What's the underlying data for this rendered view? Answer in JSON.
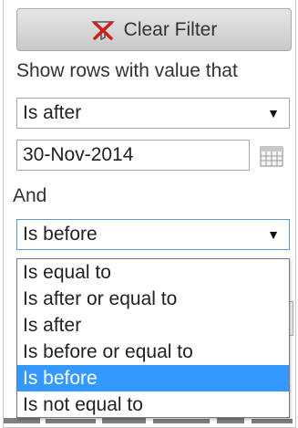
{
  "filter": {
    "clear_button_label": "Clear Filter",
    "clear_icon": "filter-clear-icon",
    "show_rows_label": "Show rows with value that",
    "first_condition": {
      "selected": "Is after",
      "arrow": "▼"
    },
    "date_value": "30-Nov-2014",
    "calendar_icon": "calendar-icon",
    "and_label": "And",
    "second_condition": {
      "selected": "Is before",
      "arrow": "▼"
    },
    "options": [
      {
        "label": "Is equal to",
        "selected": false
      },
      {
        "label": "Is after or equal to",
        "selected": false
      },
      {
        "label": "Is after",
        "selected": false
      },
      {
        "label": "Is before or equal to",
        "selected": false
      },
      {
        "label": "Is before",
        "selected": true
      },
      {
        "label": "Is not equal to",
        "selected": false
      }
    ],
    "background_fragment": "c"
  },
  "colors": {
    "highlight": "#3399ff",
    "clear_icon_red": "#d0201c",
    "focus_border": "#5a9ad6"
  }
}
